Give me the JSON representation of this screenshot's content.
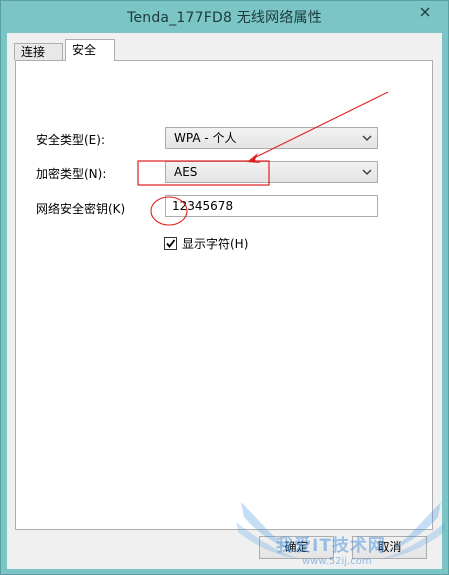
{
  "window": {
    "title": "Tenda_177FD8 无线网络属性",
    "frame_color": "#7bc5c6"
  },
  "tabs": [
    {
      "label": "连接",
      "active": false
    },
    {
      "label": "安全",
      "active": true
    }
  ],
  "security": {
    "type_label": "安全类型(E):",
    "type_value": "WPA - 个人",
    "encryption_label": "加密类型(N):",
    "encryption_value": "AES",
    "key_label": "网络安全密钥(K)",
    "key_value": "12345678",
    "show_chars_label": "显示字符(H)",
    "show_chars_checked": true
  },
  "buttons": {
    "ok_label": "确定",
    "cancel_label": "取消"
  },
  "annotations": {
    "color": "#e02020",
    "icons": [
      "red-arrow",
      "red-highlight-box",
      "red-circle"
    ]
  },
  "watermark": {
    "text": "我爱IT技术网",
    "url": "www.52ij.com"
  }
}
